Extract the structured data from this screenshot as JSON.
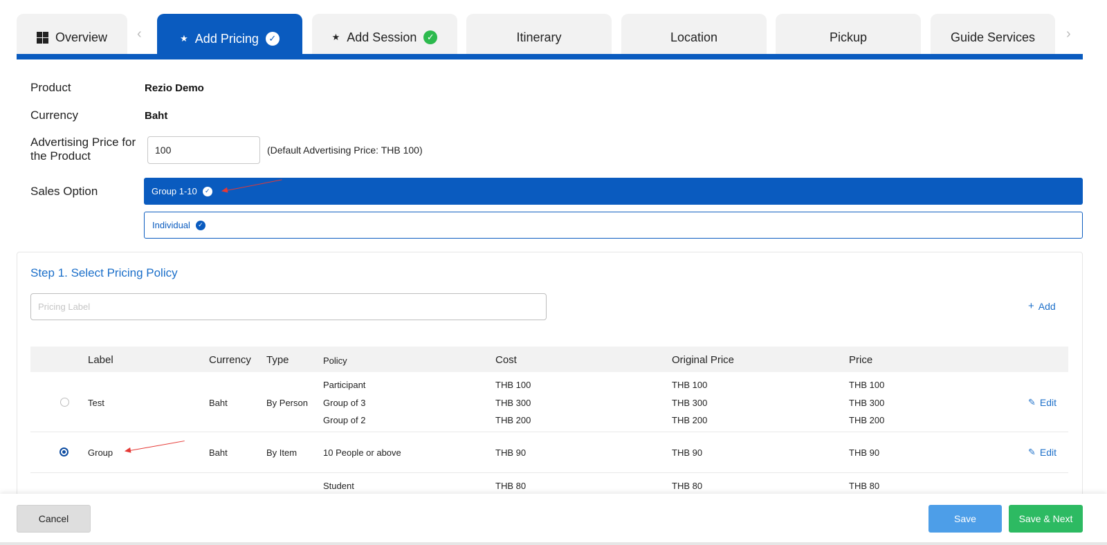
{
  "tabs": [
    {
      "label": "Overview",
      "icon": "dashboard-icon"
    },
    {
      "label": "Add Pricing",
      "icon": "star-icon",
      "status": "check-icon"
    },
    {
      "label": "Add Session",
      "icon": "star-icon",
      "status": "check-icon"
    },
    {
      "label": "Itinerary"
    },
    {
      "label": "Location"
    },
    {
      "label": "Pickup"
    },
    {
      "label": "Guide Services"
    }
  ],
  "nav": {
    "prev": "‹",
    "next": "›"
  },
  "product": {
    "label": "Product",
    "value": "Rezio Demo"
  },
  "currency": {
    "label": "Currency",
    "value": "Baht"
  },
  "advertising": {
    "label_line1": "Advertising Price for",
    "label_line2": "the Product",
    "value": "100",
    "note": "(Default Advertising Price: THB 100)"
  },
  "sales_option": {
    "label": "Sales Option",
    "options": [
      {
        "label": "Group 1-10",
        "selected": true
      },
      {
        "label": "Individual",
        "selected": false
      }
    ]
  },
  "step1": {
    "title": "Step 1. Select Pricing Policy",
    "input_placeholder": "Pricing Label",
    "add_label": "Add"
  },
  "table": {
    "headers": [
      "Label",
      "Currency",
      "Type",
      "Policy",
      "Cost",
      "Original Price",
      "Price"
    ],
    "rows": [
      {
        "label": "Test",
        "currency": "Baht",
        "type": "By Person",
        "selected": false,
        "policies": [
          {
            "policy": "Participant",
            "cost": "THB 100",
            "original": "THB 100",
            "price": "THB 100"
          },
          {
            "policy": "Group of 3",
            "cost": "THB 300",
            "original": "THB 300",
            "price": "THB 300"
          },
          {
            "policy": "Group of 2",
            "cost": "THB 200",
            "original": "THB 200",
            "price": "THB 200"
          }
        ],
        "edit": "Edit"
      },
      {
        "label": "Group",
        "currency": "Baht",
        "type": "By Item",
        "selected": true,
        "policies": [
          {
            "policy": "10 People or above",
            "cost": "THB 90",
            "original": "THB 90",
            "price": "THB 90"
          }
        ],
        "edit": "Edit"
      },
      {
        "label": "",
        "currency": "",
        "type": "",
        "selected": false,
        "policies": [
          {
            "policy": "Student",
            "cost": "THB 80",
            "original": "THB 80",
            "price": "THB 80"
          }
        ]
      }
    ]
  },
  "footer": {
    "cancel": "Cancel",
    "save": "Save",
    "save_next": "Save & Next"
  },
  "colors": {
    "primary": "#0a5bbf",
    "link": "#1a6ec9",
    "success": "#2dba62",
    "save": "#4d9ee8",
    "annotation": "#e53935"
  }
}
